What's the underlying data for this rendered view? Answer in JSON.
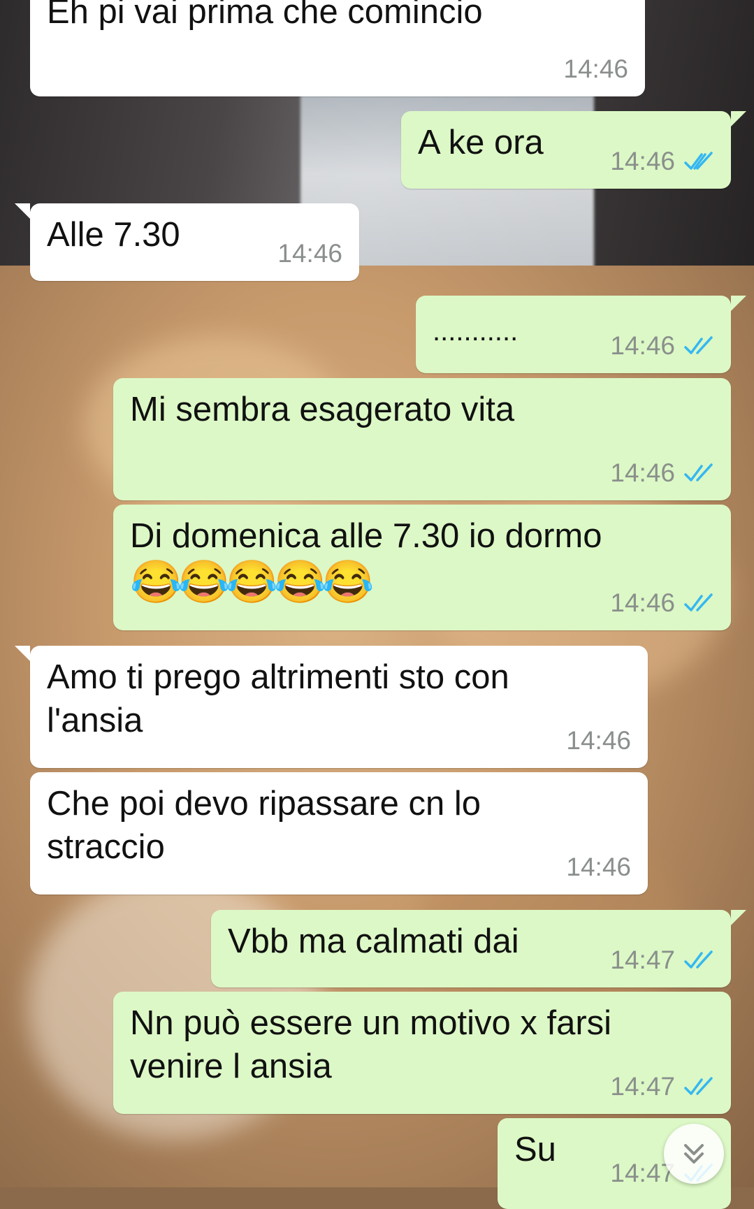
{
  "messages": [
    {
      "dir": "in",
      "text": "Eh pi vai prima che comincio",
      "time": "14:46"
    },
    {
      "dir": "out",
      "text": "A ke ora",
      "time": "14:46",
      "status": "read"
    },
    {
      "dir": "in",
      "text": "Alle 7.30",
      "time": "14:46"
    },
    {
      "dir": "out",
      "text": "...........",
      "time": "14:46",
      "status": "read"
    },
    {
      "dir": "out",
      "text": "Mi sembra esagerato vita",
      "time": "14:46",
      "status": "read"
    },
    {
      "dir": "out",
      "text": "Di domenica alle 7.30 io dormo",
      "emoji": "😂😂😂😂😂",
      "time": "14:46",
      "status": "read"
    },
    {
      "dir": "in",
      "text": "Amo ti prego altrimenti sto con l'ansia",
      "time": "14:46"
    },
    {
      "dir": "in",
      "text": "Che poi devo ripassare cn lo straccio",
      "time": "14:46"
    },
    {
      "dir": "out",
      "text": "Vbb ma calmati dai",
      "time": "14:47",
      "status": "read"
    },
    {
      "dir": "out",
      "text": "Nn può essere un motivo x farsi venire l ansia",
      "time": "14:47",
      "status": "read"
    },
    {
      "dir": "out",
      "text": "Su",
      "time": "14:47",
      "status": "read"
    }
  ],
  "colors": {
    "outgoing_bubble": "#dcf8c6",
    "incoming_bubble": "#ffffff",
    "read_ticks": "#34b7f1",
    "timestamp": "#8a8f8c"
  },
  "icons": {
    "read_receipt": "double-check-icon",
    "scroll_down": "chevron-double-down-icon"
  }
}
